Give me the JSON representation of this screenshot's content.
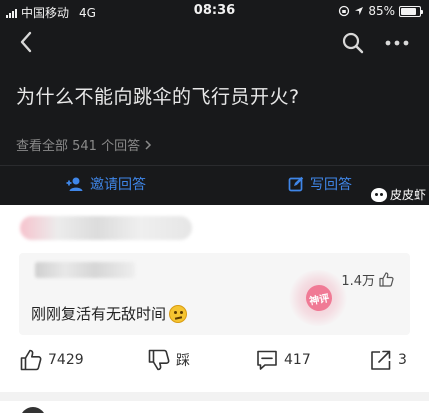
{
  "status_bar": {
    "carrier": "中国移动",
    "network": "4G",
    "time": "08:36",
    "battery_percent": "85%",
    "battery_level": 0.85
  },
  "nav": {
    "back_icon": "chevron-left-icon",
    "search_icon": "search-icon",
    "more_icon": "more-horizontal-icon"
  },
  "question": {
    "title": "为什么不能向跳伞的飞行员开火?",
    "answers_link": "查看全部 541 个回答"
  },
  "actions_bar": {
    "invite_label": "邀请回答",
    "write_label": "写回答"
  },
  "watermark": {
    "text": "皮皮虾"
  },
  "comment": {
    "likes": "1.4万",
    "text": "刚刚复活有无敌时间",
    "stamp_text": "神评"
  },
  "answer_actions": {
    "like_count": "7429",
    "dislike_label": "踩",
    "comment_count": "417",
    "share_count": "3"
  },
  "colors": {
    "dark_bg": "#18191b",
    "accent_blue": "#3f86e8",
    "stamp_pink": "#f07a95"
  }
}
